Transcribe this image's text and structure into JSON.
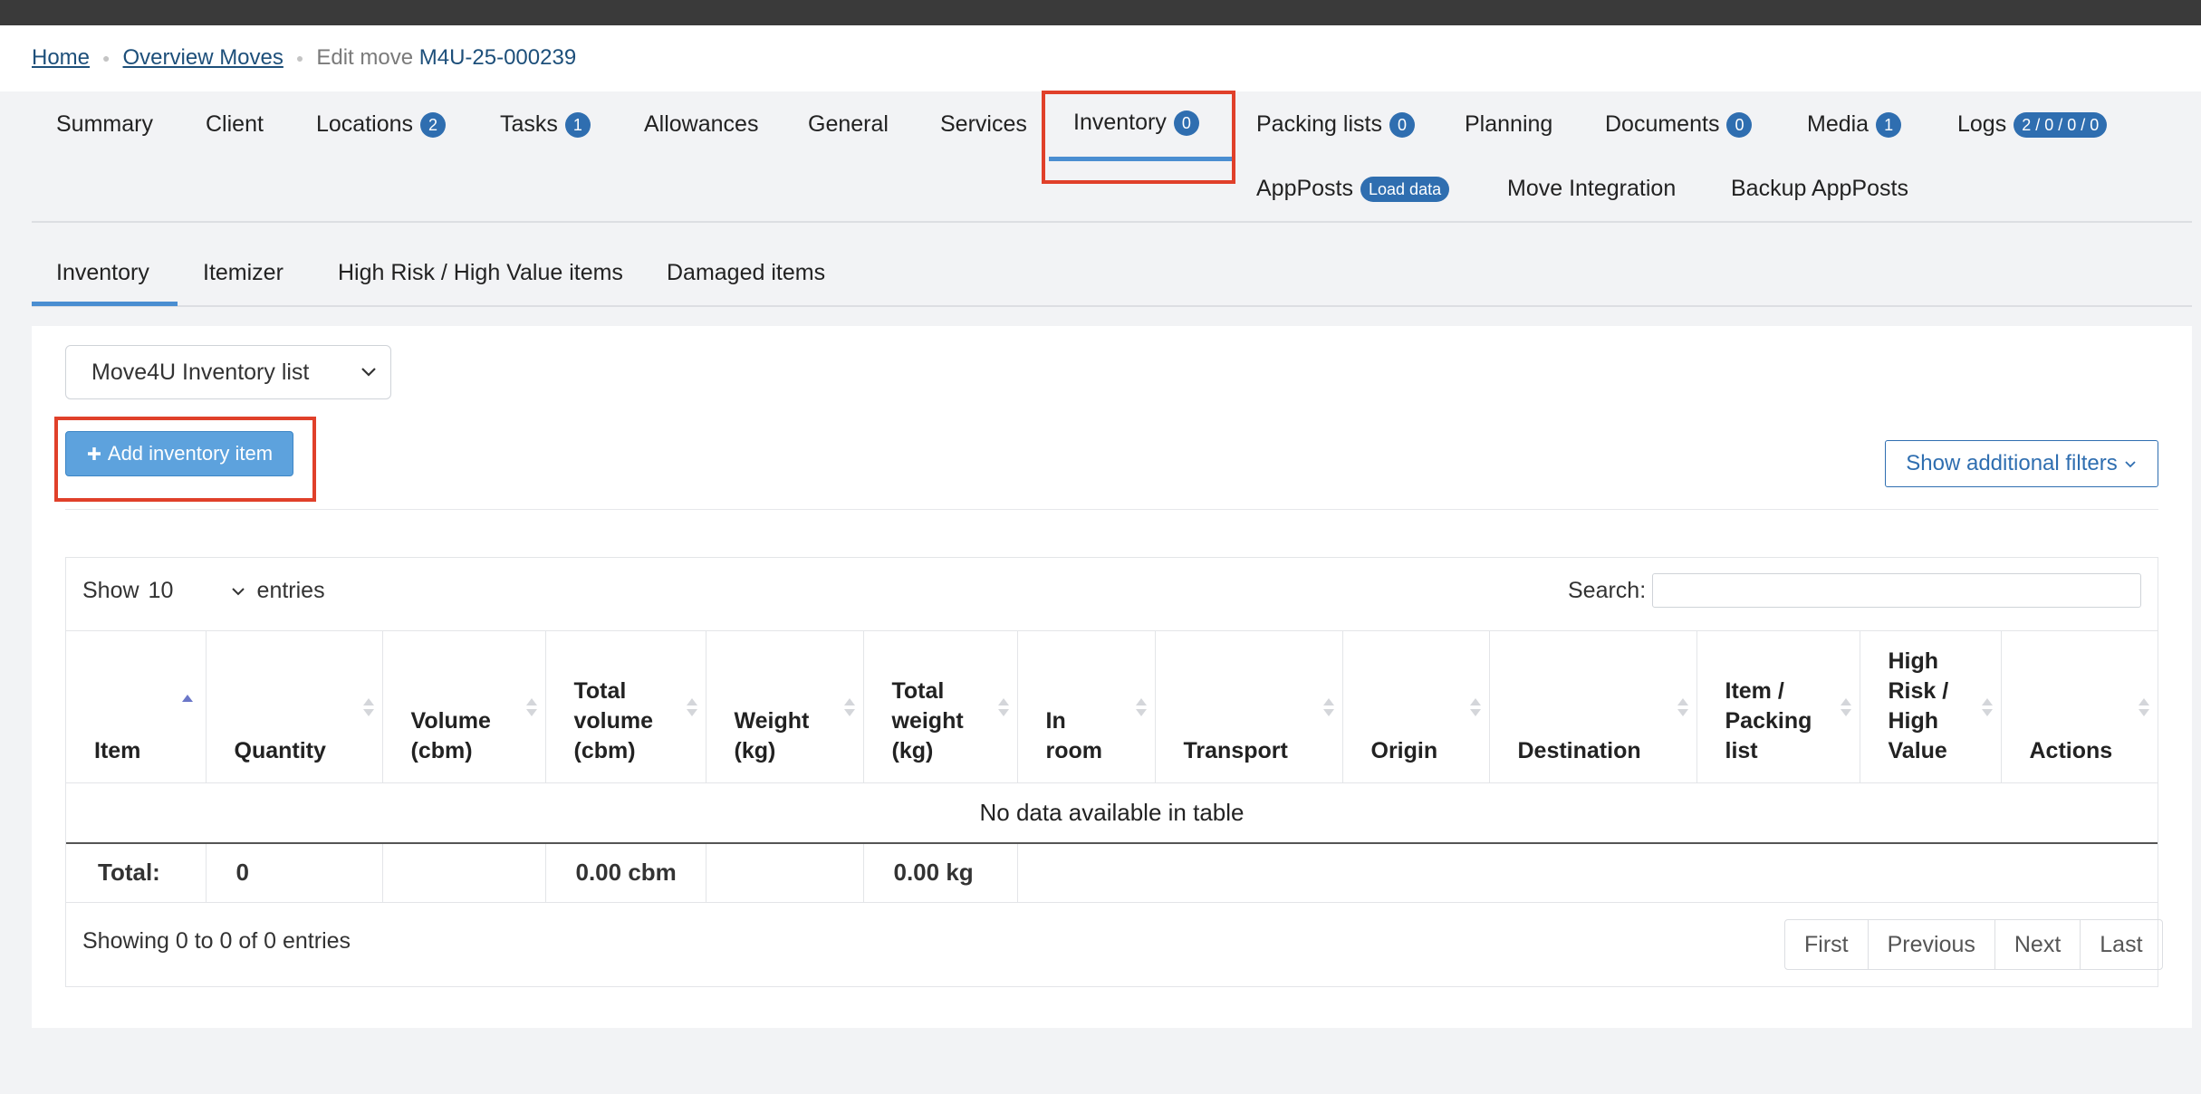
{
  "breadcrumb": {
    "home": "Home",
    "overview": "Overview Moves",
    "current_prefix": "Edit move",
    "move_id": "M4U-25-000239"
  },
  "tabs": [
    {
      "label": "Summary"
    },
    {
      "label": "Client"
    },
    {
      "label": "Locations",
      "badge": "2"
    },
    {
      "label": "Tasks",
      "badge": "1"
    },
    {
      "label": "Allowances"
    },
    {
      "label": "General"
    },
    {
      "label": "Services"
    },
    {
      "label": "Inventory",
      "badge": "0",
      "active": true
    },
    {
      "label": "Packing lists",
      "badge": "0"
    },
    {
      "label": "Planning"
    },
    {
      "label": "Documents",
      "badge": "0"
    },
    {
      "label": "Media",
      "badge": "1"
    },
    {
      "label": "Logs",
      "badge": "2 / 0 / 0 / 0"
    },
    {
      "label": "AppPosts",
      "badge": "Load data"
    },
    {
      "label": "Move Integration"
    },
    {
      "label": "Backup AppPosts"
    }
  ],
  "subtabs": [
    {
      "label": "Inventory",
      "active": true
    },
    {
      "label": "Itemizer"
    },
    {
      "label": "High Risk / High Value items"
    },
    {
      "label": "Damaged items"
    }
  ],
  "inventory_list_select": {
    "value": "Move4U Inventory list"
  },
  "add_button": "Add inventory item",
  "filters_button": "Show additional filters",
  "datatable": {
    "show_label": "Show",
    "page_length": "10",
    "entries_label": "entries",
    "search_label": "Search:",
    "search_value": "",
    "columns": [
      "Item",
      "Quantity",
      "Volume (cbm)",
      "Total volume (cbm)",
      "Weight (kg)",
      "Total weight (kg)",
      "In room",
      "Transport",
      "Origin",
      "Destination",
      "Item / Packing list",
      "High Risk / High Value",
      "Actions"
    ],
    "empty_message": "No data available in table",
    "totals": {
      "label": "Total:",
      "quantity": "0",
      "total_volume": "0.00 cbm",
      "total_weight": "0.00 kg"
    },
    "info": "Showing 0 to 0 of 0 entries",
    "pagination": [
      "First",
      "Previous",
      "Next",
      "Last"
    ]
  },
  "colors": {
    "accent": "#2f6eb0",
    "highlight": "#e0402a",
    "button": "#5da2dd"
  }
}
